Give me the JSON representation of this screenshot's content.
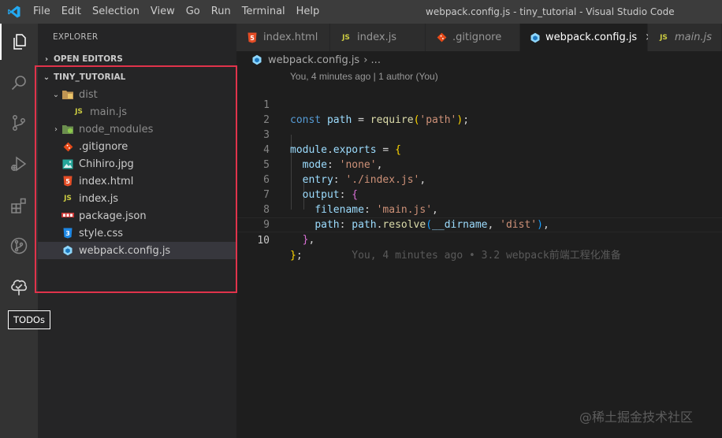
{
  "window": {
    "title": "webpack.config.js - tiny_tutorial - Visual Studio Code",
    "menu": [
      "File",
      "Edit",
      "Selection",
      "View",
      "Go",
      "Run",
      "Terminal",
      "Help"
    ]
  },
  "activity_bar": {
    "items": [
      "explorer-icon",
      "search-icon",
      "source-control-icon",
      "run-debug-icon",
      "extensions-icon",
      "git-graph-icon",
      "todo-tree-icon"
    ],
    "tooltip": "TODOs"
  },
  "explorer": {
    "title": "EXPLORER",
    "open_editors_label": "OPEN EDITORS",
    "project_label": "TINY_TUTORIAL",
    "items": [
      {
        "label": "dist",
        "icon": "folder-dist-icon",
        "chevron": "⌄",
        "dim": true
      },
      {
        "label": "main.js",
        "icon": "js-file-icon",
        "chevron": "",
        "dim": true
      },
      {
        "label": "node_modules",
        "icon": "folder-node-icon",
        "chevron": "›",
        "dim": true
      },
      {
        "label": ".gitignore",
        "icon": "git-file-icon",
        "chevron": "",
        "dim": false
      },
      {
        "label": "Chihiro.jpg",
        "icon": "image-file-icon",
        "chevron": "",
        "dim": false
      },
      {
        "label": "index.html",
        "icon": "html-file-icon",
        "chevron": "",
        "dim": false
      },
      {
        "label": "index.js",
        "icon": "js-file-icon",
        "chevron": "",
        "dim": false
      },
      {
        "label": "package.json",
        "icon": "npm-file-icon",
        "chevron": "",
        "dim": false
      },
      {
        "label": "style.css",
        "icon": "css-file-icon",
        "chevron": "",
        "dim": false
      },
      {
        "label": "webpack.config.js",
        "icon": "webpack-file-icon",
        "chevron": "",
        "dim": false,
        "selected": true
      }
    ]
  },
  "tabs": [
    {
      "label": "index.html",
      "icon": "html-file-icon"
    },
    {
      "label": "index.js",
      "icon": "js-file-icon"
    },
    {
      "label": ".gitignore",
      "icon": "git-file-icon"
    },
    {
      "label": "webpack.config.js",
      "icon": "webpack-file-icon",
      "active": true,
      "close": "×"
    },
    {
      "label": "main.js",
      "icon": "js-file-icon",
      "italic": true
    }
  ],
  "breadcrumb": {
    "file": "webpack.config.js",
    "trail": "› ..."
  },
  "editor": {
    "blame_top": "You, 4 minutes ago | 1 author (You)",
    "inline_blame": "You, 4 minutes ago • 3.2 webpack前端工程化准备",
    "line_numbers": [
      "1",
      "2",
      "3",
      "4",
      "5",
      "6",
      "7",
      "8",
      "9",
      "10"
    ],
    "tokens": {
      "const": "const",
      "path": "path",
      "eq": " = ",
      "require": "require",
      "lp": "(",
      "s_path": "'path'",
      "rp_semi": ");",
      "module": "module",
      "dot": ".",
      "exports": "exports",
      "eq2": " = ",
      "lb": "{",
      "mode": "mode",
      "colon": ": ",
      "s_none": "'none'",
      "comma": ",",
      "entry": "entry",
      "s_index": "'./index.js'",
      "output": "output",
      "filename": "filename",
      "s_main": "'main.js'",
      "path_key": "path",
      "path_obj": "path",
      "resolve": "resolve",
      "dirname": "__dirname",
      "comma_sp": ", ",
      "s_dist": "'dist'",
      "rp": ")",
      "rb": "}",
      "semi": ";"
    }
  },
  "watermark": "@稀土掘金技术社区",
  "colors": {
    "accent_border": "#e0334b",
    "editor_bg": "#1e1e1e",
    "sidebar_bg": "#252526"
  }
}
